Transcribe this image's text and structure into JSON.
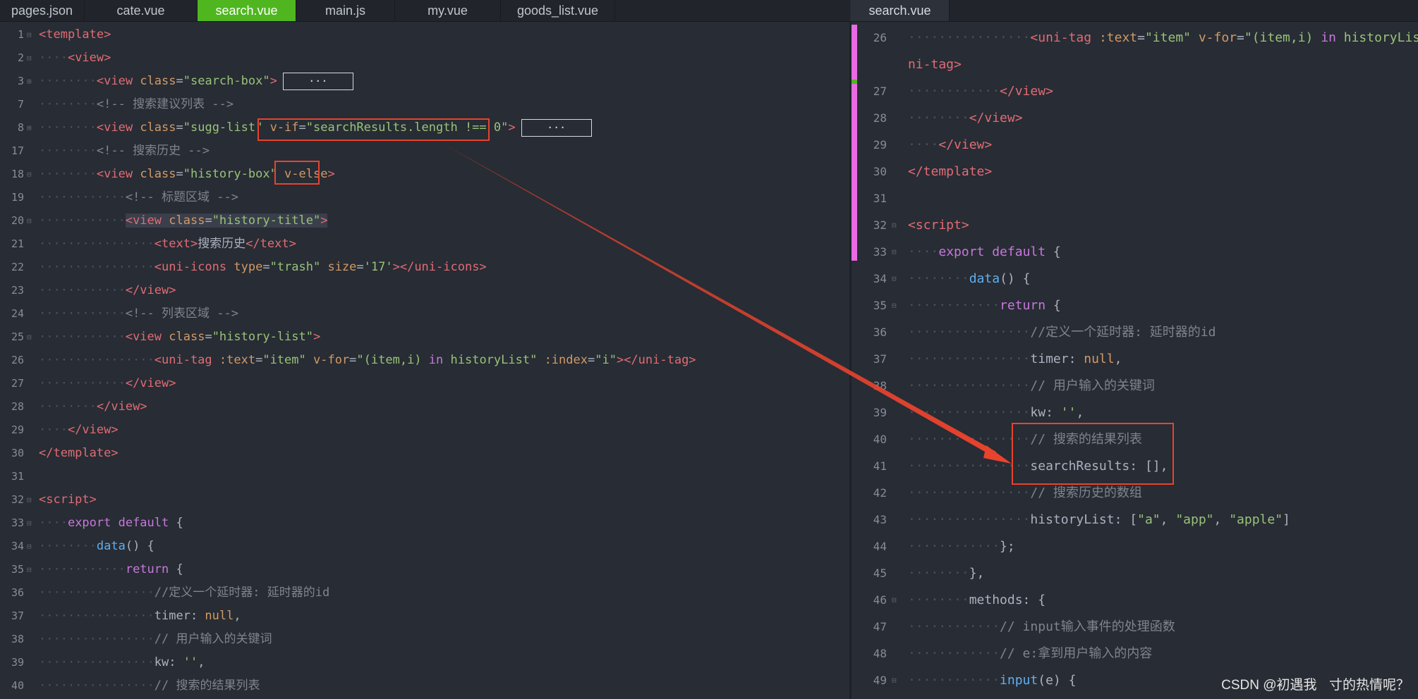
{
  "tabs": {
    "left": [
      "pages.json",
      "cate.vue",
      "search.vue",
      "main.js",
      "my.vue",
      "goods_list.vue"
    ],
    "left_active": "search.vue",
    "right": [
      "search.vue"
    ]
  },
  "colors": {
    "accent_tab": "#4fb61f",
    "annotation": "#e8432d",
    "background": "#282c34",
    "change_marker": "#e86be3"
  },
  "left_editor": {
    "lines": [
      {
        "n": "1",
        "fold": "⊟",
        "indent": 0,
        "tokens": [
          [
            "tg",
            "<template>"
          ]
        ]
      },
      {
        "n": "2",
        "fold": "⊟",
        "indent": 1,
        "tokens": [
          [
            "tg",
            "<view>"
          ]
        ]
      },
      {
        "n": "3",
        "fold": "⊞",
        "indent": 2,
        "tokens": [
          [
            "tg",
            "<view "
          ],
          [
            "at",
            "class"
          ],
          [
            "pl",
            "="
          ],
          [
            "st",
            "\"search-box\""
          ],
          [
            "tg",
            ">"
          ]
        ],
        "ellipsis": "···"
      },
      {
        "n": "7",
        "fold": "",
        "indent": 2,
        "tokens": [
          [
            "cm",
            "<!-- 搜索建议列表 -->"
          ]
        ]
      },
      {
        "n": "8",
        "fold": "⊞",
        "indent": 2,
        "tokens": [
          [
            "tg",
            "<view "
          ],
          [
            "at",
            "class"
          ],
          [
            "pl",
            "="
          ],
          [
            "st",
            "\"sugg-list\" "
          ],
          [
            "at",
            "v-if"
          ],
          [
            "pl",
            "="
          ],
          [
            "st",
            "\"searchResults.length !== 0\""
          ],
          [
            "tg",
            ">"
          ]
        ],
        "ellipsis": "···"
      },
      {
        "n": "17",
        "fold": "",
        "indent": 2,
        "tokens": [
          [
            "cm",
            "<!-- 搜索历史 -->"
          ]
        ]
      },
      {
        "n": "18",
        "fold": "⊟",
        "indent": 2,
        "tokens": [
          [
            "tg",
            "<view "
          ],
          [
            "at",
            "class"
          ],
          [
            "pl",
            "="
          ],
          [
            "st",
            "\"history-box\" "
          ],
          [
            "at",
            "v-else"
          ],
          [
            "tg",
            ">"
          ]
        ]
      },
      {
        "n": "19",
        "fold": "",
        "indent": 3,
        "tokens": [
          [
            "cm",
            "<!-- 标题区域 -->"
          ]
        ]
      },
      {
        "n": "20",
        "fold": "⊟",
        "indent": 3,
        "hl": true,
        "tokens": [
          [
            "tg",
            "<view "
          ],
          [
            "at",
            "class"
          ],
          [
            "pl",
            "="
          ],
          [
            "st",
            "\"history-title\""
          ],
          [
            "tg",
            ">"
          ]
        ]
      },
      {
        "n": "21",
        "fold": "",
        "indent": 4,
        "tokens": [
          [
            "tg",
            "<text>"
          ],
          [
            "pl",
            "搜索历史"
          ],
          [
            "tg",
            "</text>"
          ]
        ]
      },
      {
        "n": "22",
        "fold": "",
        "indent": 4,
        "tokens": [
          [
            "tg",
            "<uni-icons "
          ],
          [
            "at",
            "type"
          ],
          [
            "pl",
            "="
          ],
          [
            "st",
            "\"trash\" "
          ],
          [
            "at",
            "size"
          ],
          [
            "pl",
            "="
          ],
          [
            "st",
            "'17'"
          ],
          [
            "tg",
            "></uni-icons>"
          ]
        ]
      },
      {
        "n": "23",
        "fold": "",
        "indent": 3,
        "tokens": [
          [
            "tg",
            "</view>"
          ]
        ]
      },
      {
        "n": "24",
        "fold": "",
        "indent": 3,
        "tokens": [
          [
            "cm",
            "<!-- 列表区域 -->"
          ]
        ]
      },
      {
        "n": "25",
        "fold": "⊟",
        "indent": 3,
        "tokens": [
          [
            "tg",
            "<view "
          ],
          [
            "at",
            "class"
          ],
          [
            "pl",
            "="
          ],
          [
            "st",
            "\"history-list\""
          ],
          [
            "tg",
            ">"
          ]
        ]
      },
      {
        "n": "26",
        "fold": "",
        "indent": 4,
        "tokens": [
          [
            "tg",
            "<uni-tag "
          ],
          [
            "at",
            ":text"
          ],
          [
            "pl",
            "="
          ],
          [
            "st",
            "\"item\" "
          ],
          [
            "at",
            "v-for"
          ],
          [
            "pl",
            "="
          ],
          [
            "st",
            "\"(item,i) "
          ],
          [
            "kw",
            "in"
          ],
          [
            "st",
            " historyList\" "
          ],
          [
            "at",
            ":index"
          ],
          [
            "pl",
            "="
          ],
          [
            "st",
            "\"i\""
          ],
          [
            "tg",
            "></uni-tag>"
          ]
        ]
      },
      {
        "n": "27",
        "fold": "",
        "indent": 3,
        "tokens": [
          [
            "tg",
            "</view>"
          ]
        ]
      },
      {
        "n": "28",
        "fold": "",
        "indent": 2,
        "tokens": [
          [
            "tg",
            "</view>"
          ]
        ]
      },
      {
        "n": "29",
        "fold": "",
        "indent": 1,
        "tokens": [
          [
            "tg",
            "</view>"
          ]
        ]
      },
      {
        "n": "30",
        "fold": "",
        "indent": 0,
        "tokens": [
          [
            "tg",
            "</template>"
          ]
        ]
      },
      {
        "n": "31",
        "fold": "",
        "indent": 0,
        "tokens": []
      },
      {
        "n": "32",
        "fold": "⊟",
        "indent": 0,
        "tokens": [
          [
            "tg",
            "<script>"
          ]
        ]
      },
      {
        "n": "33",
        "fold": "⊟",
        "indent": 1,
        "tokens": [
          [
            "kw",
            "export default "
          ],
          [
            "pl",
            "{"
          ]
        ]
      },
      {
        "n": "34",
        "fold": "⊟",
        "indent": 2,
        "tokens": [
          [
            "fn",
            "data"
          ],
          [
            "pl",
            "() {"
          ]
        ]
      },
      {
        "n": "35",
        "fold": "⊟",
        "indent": 3,
        "tokens": [
          [
            "kw",
            "return "
          ],
          [
            "pl",
            "{"
          ]
        ]
      },
      {
        "n": "36",
        "fold": "",
        "indent": 4,
        "tokens": [
          [
            "cm",
            "//定义一个延时器: 延时器的id"
          ]
        ]
      },
      {
        "n": "37",
        "fold": "",
        "indent": 4,
        "tokens": [
          [
            "pl",
            "timer: "
          ],
          [
            "nl",
            "null"
          ],
          [
            "pl",
            ","
          ]
        ]
      },
      {
        "n": "38",
        "fold": "",
        "indent": 4,
        "tokens": [
          [
            "cm",
            "// 用户输入的关键词"
          ]
        ]
      },
      {
        "n": "39",
        "fold": "",
        "indent": 4,
        "tokens": [
          [
            "pl",
            "kw: "
          ],
          [
            "st",
            "''"
          ],
          [
            "pl",
            ","
          ]
        ]
      },
      {
        "n": "40",
        "fold": "",
        "indent": 4,
        "tokens": [
          [
            "cm",
            "// 搜索的结果列表"
          ]
        ]
      }
    ]
  },
  "right_editor": {
    "lines": [
      {
        "n": "26",
        "fold": "",
        "indent": 4,
        "tokens": [
          [
            "tg",
            "<uni-tag "
          ],
          [
            "at",
            ":text"
          ],
          [
            "pl",
            "="
          ],
          [
            "st",
            "\"item\" "
          ],
          [
            "at",
            "v-for"
          ],
          [
            "pl",
            "="
          ],
          [
            "st",
            "\"(item,i) "
          ],
          [
            "kw",
            "in"
          ],
          [
            "st",
            " historyList"
          ]
        ]
      },
      {
        "n": "",
        "fold": "",
        "indent": 0,
        "noguide": true,
        "tokens": [
          [
            "tg",
            "ni-tag>"
          ]
        ]
      },
      {
        "n": "27",
        "fold": "",
        "indent": 3,
        "tokens": [
          [
            "tg",
            "</view>"
          ]
        ]
      },
      {
        "n": "28",
        "fold": "",
        "indent": 2,
        "tokens": [
          [
            "tg",
            "</view>"
          ]
        ]
      },
      {
        "n": "29",
        "fold": "",
        "indent": 1,
        "tokens": [
          [
            "tg",
            "</view>"
          ]
        ]
      },
      {
        "n": "30",
        "fold": "",
        "indent": 0,
        "tokens": [
          [
            "tg",
            "</template>"
          ]
        ]
      },
      {
        "n": "31",
        "fold": "",
        "indent": 0,
        "tokens": []
      },
      {
        "n": "32",
        "fold": "⊟",
        "indent": 0,
        "tokens": [
          [
            "tg",
            "<script>"
          ]
        ]
      },
      {
        "n": "33",
        "fold": "⊟",
        "indent": 1,
        "tokens": [
          [
            "kw",
            "export default "
          ],
          [
            "pl",
            "{"
          ]
        ]
      },
      {
        "n": "34",
        "fold": "⊟",
        "indent": 2,
        "tokens": [
          [
            "fn",
            "data"
          ],
          [
            "pl",
            "() {"
          ]
        ]
      },
      {
        "n": "35",
        "fold": "⊟",
        "indent": 3,
        "tokens": [
          [
            "kw",
            "return "
          ],
          [
            "pl",
            "{"
          ]
        ]
      },
      {
        "n": "36",
        "fold": "",
        "indent": 4,
        "tokens": [
          [
            "cm",
            "//定义一个延时器: 延时器的id"
          ]
        ]
      },
      {
        "n": "37",
        "fold": "",
        "indent": 4,
        "tokens": [
          [
            "pl",
            "timer: "
          ],
          [
            "nl",
            "null"
          ],
          [
            "pl",
            ","
          ]
        ]
      },
      {
        "n": "38",
        "fold": "",
        "indent": 4,
        "tokens": [
          [
            "cm",
            "// 用户输入的关键词"
          ]
        ]
      },
      {
        "n": "39",
        "fold": "",
        "indent": 4,
        "tokens": [
          [
            "pl",
            "kw: "
          ],
          [
            "st",
            "''"
          ],
          [
            "pl",
            ","
          ]
        ]
      },
      {
        "n": "40",
        "fold": "",
        "indent": 4,
        "tokens": [
          [
            "cm",
            "// 搜索的结果列表"
          ]
        ]
      },
      {
        "n": "41",
        "fold": "",
        "indent": 4,
        "tokens": [
          [
            "pl",
            "searchResults: [],"
          ]
        ]
      },
      {
        "n": "42",
        "fold": "",
        "indent": 4,
        "tokens": [
          [
            "cm",
            "// 搜索历史的数组"
          ]
        ]
      },
      {
        "n": "43",
        "fold": "",
        "indent": 4,
        "tokens": [
          [
            "pl",
            "historyList: ["
          ],
          [
            "st",
            "\"a\""
          ],
          [
            "pl",
            ", "
          ],
          [
            "st",
            "\"app\""
          ],
          [
            "pl",
            ", "
          ],
          [
            "st",
            "\"apple\""
          ],
          [
            "pl",
            "]"
          ]
        ]
      },
      {
        "n": "44",
        "fold": "",
        "indent": 3,
        "tokens": [
          [
            "pl",
            "};"
          ]
        ]
      },
      {
        "n": "45",
        "fold": "",
        "indent": 2,
        "tokens": [
          [
            "pl",
            "},"
          ]
        ]
      },
      {
        "n": "46",
        "fold": "⊟",
        "indent": 2,
        "tokens": [
          [
            "pl",
            "methods: {"
          ]
        ]
      },
      {
        "n": "47",
        "fold": "",
        "indent": 3,
        "tokens": [
          [
            "cm",
            "// input输入事件的处理函数"
          ]
        ]
      },
      {
        "n": "48",
        "fold": "",
        "indent": 3,
        "tokens": [
          [
            "cm",
            "// e:拿到用户输入的内容"
          ]
        ]
      },
      {
        "n": "49",
        "fold": "⊟",
        "indent": 3,
        "tokens": [
          [
            "fn",
            "input"
          ],
          [
            "pl",
            "(e) {"
          ]
        ]
      }
    ]
  },
  "watermark": "CSDN @初遇我ㅤ寸的热情呢？"
}
